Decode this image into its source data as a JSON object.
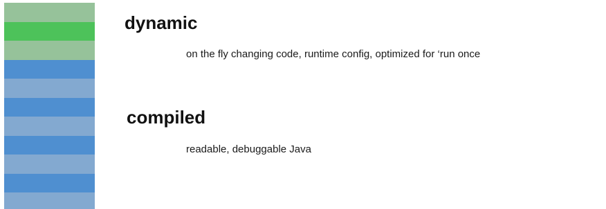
{
  "stripes": [
    {
      "color": "#96c29a",
      "section": "dynamic"
    },
    {
      "color": "#4dc25a",
      "section": "dynamic"
    },
    {
      "color": "#96c29a",
      "section": "dynamic"
    },
    {
      "color": "#4f8fd0",
      "section": "compiled"
    },
    {
      "color": "#83a9d0",
      "section": "compiled"
    },
    {
      "color": "#4f8fd0",
      "section": "compiled"
    },
    {
      "color": "#83a9d0",
      "section": "compiled"
    },
    {
      "color": "#4f8fd0",
      "section": "compiled"
    },
    {
      "color": "#83a9d0",
      "section": "compiled"
    },
    {
      "color": "#4f8fd0",
      "section": "compiled"
    },
    {
      "color": "#83a9d0",
      "section": "compiled"
    }
  ],
  "dynamic": {
    "title": "dynamic",
    "description": "on the fly changing code, runtime config, optimized for ‘run once"
  },
  "compiled": {
    "title": "compiled",
    "description": "readable, debuggable Java"
  }
}
